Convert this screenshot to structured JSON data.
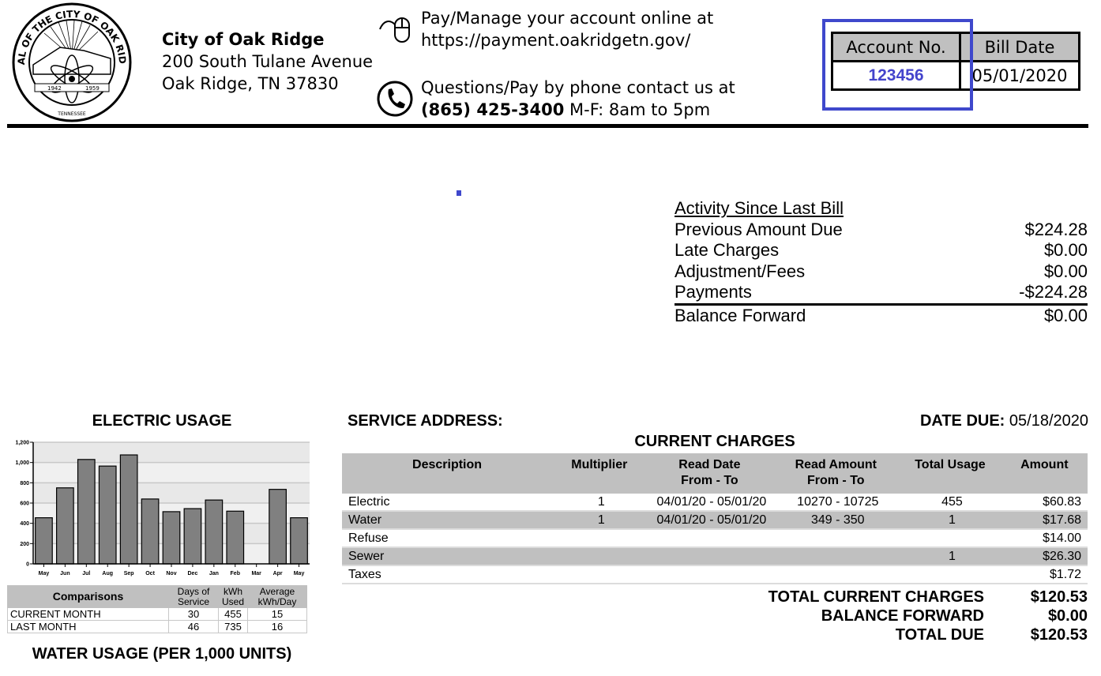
{
  "header": {
    "seal": {
      "text_top": "SEAL OF THE CITY OF OAK RIDGE",
      "text_bottom": "TENNESSEE",
      "year_left": "1942",
      "year_right": "1959"
    },
    "org_name": "City of Oak Ridge",
    "address_line1": "200 South Tulane Avenue",
    "address_line2": "Oak Ridge, TN 37830",
    "online_line1": "Pay/Manage your account online at",
    "online_url": "https://payment.oakridgetn.gov/",
    "phone_line1": "Questions/Pay by phone contact us at",
    "phone_number": "(865) 425-3400",
    "phone_hours": " M-F: 8am to 5pm",
    "icons": {
      "online": "mouse-icon",
      "phone": "phone-icon"
    }
  },
  "account": {
    "account_label": "Account No.",
    "account_number": "123456",
    "bill_date_label": "Bill Date",
    "bill_date": "05/01/2020",
    "highlight_color": "#3f48cc"
  },
  "activity": {
    "title": "Activity Since Last Bill",
    "rows": [
      {
        "label": "Previous Amount Due",
        "value": "$224.28"
      },
      {
        "label": "Late Charges",
        "value": "$0.00"
      },
      {
        "label": "Adjustment/Fees",
        "value": "$0.00"
      },
      {
        "label": "Payments",
        "value": "-$224.28"
      }
    ],
    "balance_forward": {
      "label": "Balance Forward",
      "value": "$0.00"
    }
  },
  "electric": {
    "title": "ELECTRIC USAGE",
    "comparisons": {
      "headers": [
        "Comparisons",
        "Days of Service",
        "kWh Used",
        "Average kWh/Day"
      ],
      "rows": [
        [
          "CURRENT MONTH",
          "30",
          "455",
          "15"
        ],
        [
          "LAST MONTH",
          "46",
          "735",
          "16"
        ]
      ]
    }
  },
  "chart_data": {
    "type": "bar",
    "title": "ELECTRIC USAGE",
    "xlabel": "",
    "ylabel": "",
    "categories": [
      "May",
      "Jun",
      "Jul",
      "Aug",
      "Sep",
      "Oct",
      "Nov",
      "Dec",
      "Jan",
      "Feb",
      "Mar",
      "Apr",
      "May"
    ],
    "values": [
      455,
      750,
      1030,
      965,
      1075,
      640,
      515,
      545,
      630,
      520,
      0,
      735,
      455
    ],
    "ylim": [
      0,
      1200
    ],
    "yticks": [
      0,
      200,
      400,
      600,
      800,
      1000,
      1200
    ],
    "ytick_labels": [
      "0",
      "200",
      "400",
      "600",
      "800",
      "1,000",
      "1,200"
    ],
    "grid": true,
    "legend": "none",
    "bar_color": "#808080"
  },
  "water": {
    "title": "WATER USAGE (PER 1,000 UNITS)"
  },
  "service": {
    "address_label": "SERVICE ADDRESS:",
    "date_due_label": "DATE DUE:",
    "date_due": " 05/18/2020",
    "current_charges_title": "CURRENT CHARGES",
    "columns": [
      {
        "line1": "Description",
        "line2": ""
      },
      {
        "line1": "Multiplier",
        "line2": ""
      },
      {
        "line1": "Read Date",
        "line2": "From - To"
      },
      {
        "line1": "Read Amount",
        "line2": "From - To"
      },
      {
        "line1": "Total Usage",
        "line2": ""
      },
      {
        "line1": "Amount",
        "line2": ""
      }
    ],
    "rows": [
      {
        "description": "Electric",
        "multiplier": "1",
        "read_date": "04/01/20 - 05/01/20",
        "read_amount": "10270 - 10725",
        "total_usage": "455",
        "amount": "$60.83"
      },
      {
        "description": "Water",
        "multiplier": "1",
        "read_date": "04/01/20 - 05/01/20",
        "read_amount": "349 - 350",
        "total_usage": "1",
        "amount": "$17.68"
      },
      {
        "description": "Refuse",
        "multiplier": "",
        "read_date": "",
        "read_amount": "",
        "total_usage": "",
        "amount": "$14.00"
      },
      {
        "description": "Sewer",
        "multiplier": "",
        "read_date": "",
        "read_amount": "",
        "total_usage": "1",
        "amount": "$26.30"
      },
      {
        "description": "Taxes",
        "multiplier": "",
        "read_date": "",
        "read_amount": "",
        "total_usage": "",
        "amount": "$1.72"
      }
    ],
    "totals": [
      {
        "label": "TOTAL CURRENT CHARGES",
        "value": "$120.53"
      },
      {
        "label": "BALANCE FORWARD",
        "value": "$0.00"
      },
      {
        "label": "TOTAL DUE",
        "value": "$120.53"
      }
    ]
  }
}
